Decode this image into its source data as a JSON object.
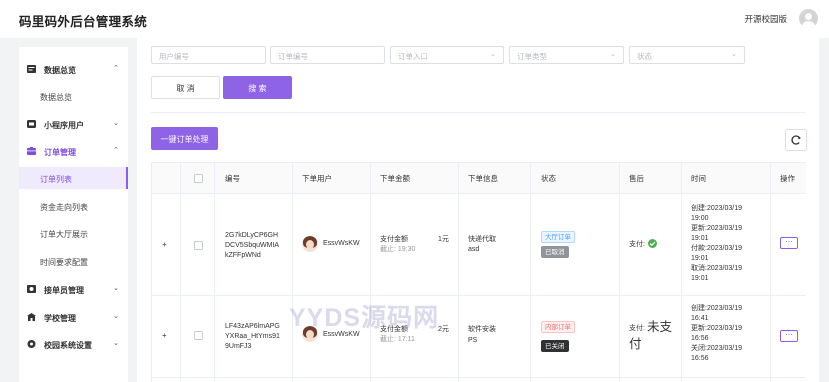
{
  "app": {
    "title": "码里码外后台管理系统",
    "version_link": "开源校园版"
  },
  "sidebar": {
    "groups": [
      {
        "label": "数据总览",
        "chevron": "⌃",
        "icon": "dashboard-icon"
      },
      {
        "label": "小程序用户",
        "chevron": "⌄",
        "icon": "users-icon"
      },
      {
        "label": "订单管理",
        "chevron": "⌃",
        "icon": "orders-icon"
      },
      {
        "label": "接单员管理",
        "chevron": "⌄",
        "icon": "courier-icon"
      },
      {
        "label": "学校管理",
        "chevron": "⌄",
        "icon": "school-icon"
      },
      {
        "label": "校园系统设置",
        "chevron": "⌄",
        "icon": "settings-icon"
      }
    ],
    "subitems": [
      "数据总览",
      "订单列表",
      "资金走向列表",
      "订单大厅展示",
      "时间要求配置"
    ]
  },
  "filters": {
    "user_no": "用户编号",
    "order_no": "订单编号",
    "order_entry": "订单入口",
    "order_type": "订单类型",
    "status": "状态"
  },
  "actions": {
    "cancel": "取 消",
    "search": "搜 索",
    "batch": "一键订单处理"
  },
  "table": {
    "headers": [
      "编号",
      "下单用户",
      "下单金额",
      "下单信息",
      "状态",
      "售后",
      "时间",
      "操作"
    ],
    "rows": [
      {
        "id_lines": [
          "2G7kDLyCP6GH",
          "DCV5SbquWMIA",
          "kZFFpWNd"
        ],
        "user": "EssvWsKW",
        "amount_label": "支付金额",
        "amount_value": "1元",
        "deadline": "截止: 19:30",
        "info_title": "快递代取",
        "info_sub": "asd",
        "tag1": "大厅订单",
        "tag2": "已取消",
        "after_sale": "支付:",
        "time_lines": [
          "创建:2023/03/19",
          "19:00",
          "更新:2023/03/19",
          "19:01",
          "付款:2023/03/19",
          "19:01",
          "取消:2023/03/19",
          "19:01"
        ],
        "more": "···"
      },
      {
        "id_lines": [
          "LF43zAP6lmAPG",
          "YXRaa_HtYms91",
          "9UmFJ3"
        ],
        "user": "EssvWsKW",
        "amount_label": "支付金额",
        "amount_value": "2元",
        "deadline": "截止: 17:11",
        "info_title": "软件安装",
        "info_sub": "PS",
        "tag1": "内部订单",
        "tag2": "已关闭",
        "after_sale": "支付:",
        "after_sale_big": "未支付",
        "time_lines": [
          "创建:2023/03/19",
          "16:41",
          "更新:2023/03/19",
          "16:56",
          "关闭:2023/03/19",
          "16:56"
        ],
        "more": "···"
      }
    ]
  },
  "watermark": "YYDS源码网",
  "colors": {
    "accent": "#8f63e6",
    "active_bg": "#f0ebfc"
  }
}
